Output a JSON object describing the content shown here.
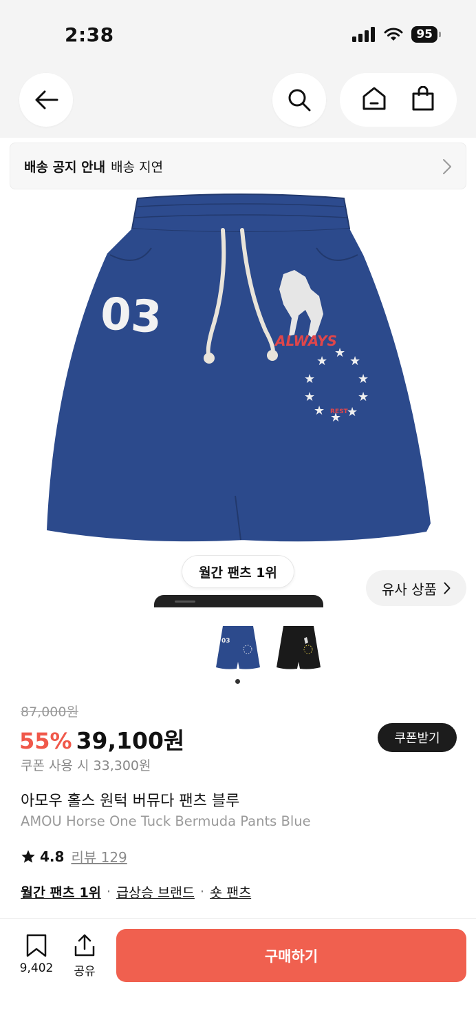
{
  "status_bar": {
    "time": "2:38",
    "battery": "95"
  },
  "nav": {
    "back_icon": "arrow-left-icon",
    "search_icon": "search-icon",
    "home_icon": "home-icon",
    "cart_icon": "shopping-bag-icon"
  },
  "notice": {
    "title": "배송 공지 안내",
    "text": "배송 지연"
  },
  "product_image": {
    "print_number": "03",
    "print_word": "ALWAYS",
    "print_small": "REST",
    "color_main": "#2c4a8c"
  },
  "badges": {
    "monthly_rank": "월간 팬츠 1위",
    "similar": "유사 상품"
  },
  "thumbnails": [
    {
      "label": "blue",
      "color": "#2c4a8c"
    },
    {
      "label": "black",
      "color": "#1a1a1a"
    }
  ],
  "pricing": {
    "original": "87,000원",
    "discount": "55%",
    "sale": "39,100원",
    "coupon_button": "쿠폰받기",
    "coupon_price": "쿠폰 사용 시 33,300원"
  },
  "product": {
    "name_ko": "아모우 홀스 원턱 버뮤다 팬츠 블루",
    "name_en": "AMOU Horse One Tuck Bermuda Pants Blue"
  },
  "rating": {
    "value": "4.8",
    "review_label": "리뷰 129"
  },
  "tags": [
    "월간 팬츠 1위",
    "급상승 브랜드",
    "숏 팬츠"
  ],
  "tag_separator": "·",
  "bottom": {
    "bookmark_count": "9,402",
    "share_label": "공유",
    "buy_label": "구매하기"
  },
  "colors": {
    "accent": "#f0604f",
    "discount": "#f0584a",
    "dark": "#1c1c1c"
  }
}
